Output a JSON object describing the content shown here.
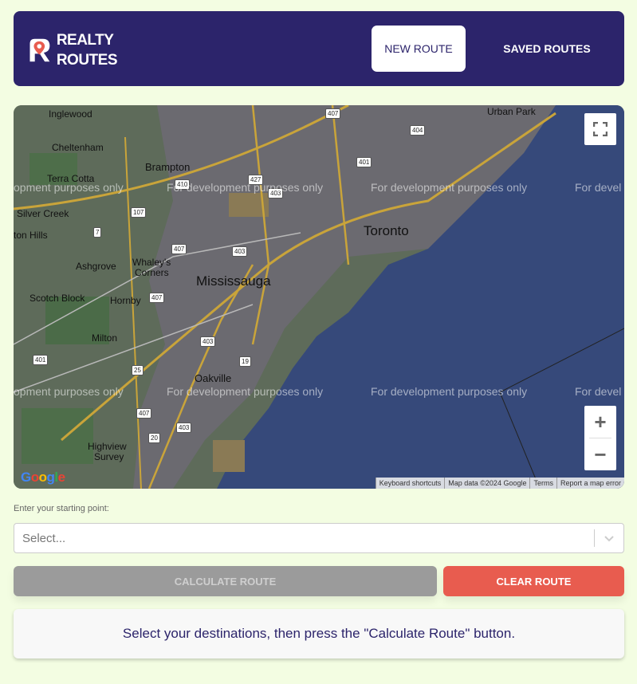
{
  "header": {
    "logo_line1": "REALTY",
    "logo_line2": "ROUTES",
    "nav_new": "NEW ROUTE",
    "nav_saved": "SAVED ROUTES",
    "bg_color": "#2c246b"
  },
  "map": {
    "watermark": "For development purposes only",
    "watermark_partial_left": "opment purposes only",
    "watermark_partial_right": "For devel",
    "labels": {
      "inglewood": "Inglewood",
      "cheltenham": "Cheltenham",
      "brampton": "Brampton",
      "terra_cotta": "Terra Cotta",
      "silver_creek": "Silver Creek",
      "ton_hills": "ton Hills",
      "ashgrove": "Ashgrove",
      "whaleys": "Whaley's",
      "corners": "Corners",
      "mississauga": "Mississauga",
      "toronto": "Toronto",
      "scotch_block": "Scotch Block",
      "hornby": "Hornby",
      "milton": "Milton",
      "oakville": "Oakville",
      "highview": "Highview",
      "survey": "Survey",
      "urban_park": "Urban Park"
    },
    "shields": [
      "407",
      "404",
      "401",
      "427",
      "410",
      "403",
      "107",
      "7",
      "407",
      "403",
      "407",
      "403",
      "401",
      "25",
      "19",
      "407",
      "403",
      "20"
    ],
    "zoom_in": "+",
    "zoom_out": "−",
    "google": "Google",
    "attribution": [
      "Keyboard shortcuts",
      "Map data ©2024 Google",
      "Terms",
      "Report a map error"
    ]
  },
  "form": {
    "start_label": "Enter your starting point:",
    "select_placeholder": "Select...",
    "calculate_label": "CALCULATE ROUTE",
    "clear_label": "CLEAR ROUTE",
    "info_text": "Select your destinations, then press the \"Calculate Route\" button."
  }
}
